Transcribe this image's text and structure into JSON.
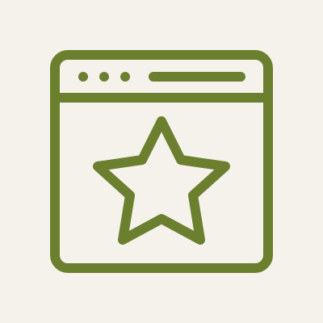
{
  "icon": {
    "name": "browser-window-star-icon",
    "color": "#6b7f2e",
    "background": "#f5f2ec"
  }
}
